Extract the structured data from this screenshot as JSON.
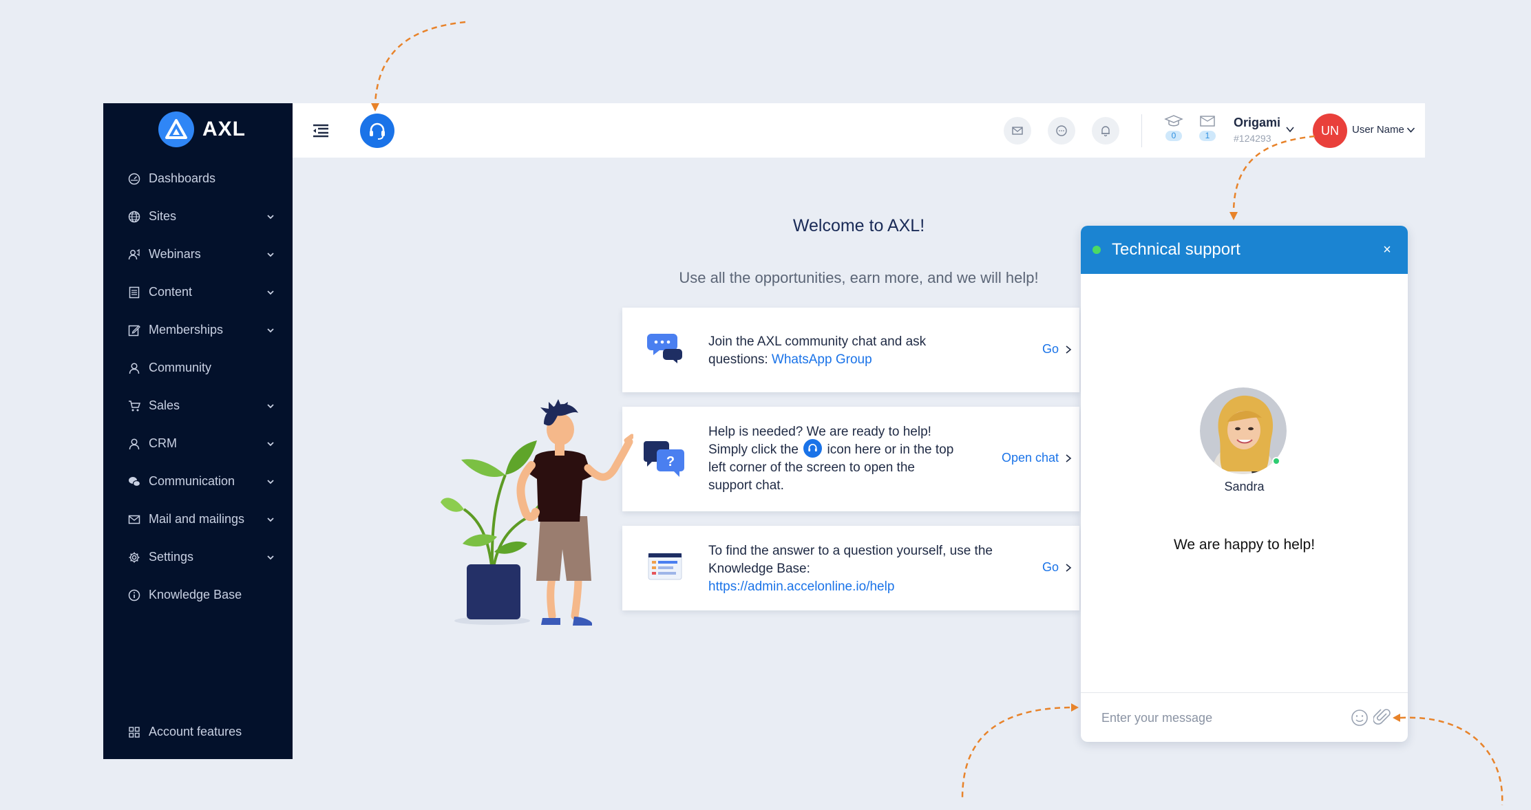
{
  "brand": {
    "name": "AXL"
  },
  "sidebar": {
    "items": [
      {
        "label": "Dashboards",
        "icon": "dashboard-icon",
        "expandable": false
      },
      {
        "label": "Sites",
        "icon": "globe-icon",
        "expandable": true
      },
      {
        "label": "Webinars",
        "icon": "webinar-icon",
        "expandable": true
      },
      {
        "label": "Content",
        "icon": "content-icon",
        "expandable": true
      },
      {
        "label": "Memberships",
        "icon": "edit-icon",
        "expandable": true
      },
      {
        "label": "Community",
        "icon": "user-icon",
        "expandable": false
      },
      {
        "label": "Sales",
        "icon": "cart-icon",
        "expandable": true
      },
      {
        "label": "CRM",
        "icon": "user-icon",
        "expandable": true
      },
      {
        "label": "Communication",
        "icon": "chat-icon",
        "expandable": true
      },
      {
        "label": "Mail and mailings",
        "icon": "mail-icon",
        "expandable": true
      },
      {
        "label": "Settings",
        "icon": "gear-icon",
        "expandable": true
      },
      {
        "label": "Knowledge Base",
        "icon": "info-icon",
        "expandable": false
      }
    ],
    "bottom_item": {
      "label": "Account features",
      "icon": "grid-icon"
    }
  },
  "header": {
    "counters": [
      {
        "icon": "graduation-cap-icon",
        "value": "0"
      },
      {
        "icon": "inbox-icon",
        "value": "1"
      }
    ],
    "project": {
      "name": "Origami",
      "id": "#124293"
    },
    "user": {
      "initials": "UN",
      "name": "User Name",
      "avatar_color": "#e9403b"
    }
  },
  "main": {
    "title": "Welcome to AXL!",
    "subtitle": "Use all the opportunities, earn more, and we will help!",
    "cards": [
      {
        "line1": "Join the AXL community chat and ask",
        "line2_prefix": "questions: ",
        "link_text": "WhatsApp Group",
        "action": "Go"
      },
      {
        "line1": "Help is needed? We are ready to help!",
        "line2_before_icon": "Simply click the",
        "line2_after_icon": "icon here or in the top",
        "line3": "left corner of the screen to open the",
        "line4": "support chat.",
        "action": "Open chat"
      },
      {
        "line1": "To find the answer to a question yourself, use the",
        "line2": "Knowledge Base:",
        "link_text": "https://admin.accelonline.io/help",
        "action": "Go"
      }
    ]
  },
  "chat": {
    "title": "Technical support",
    "close": "×",
    "agent_name": "Sandra",
    "message": "We are happy to help!",
    "input_placeholder": "Enter your message"
  },
  "colors": {
    "sidebar_bg": "#03112b",
    "accent": "#1a73e8",
    "chat_header": "#1b84d2",
    "annotation_arrow": "#e8832a",
    "avatar_red": "#e9403b"
  }
}
